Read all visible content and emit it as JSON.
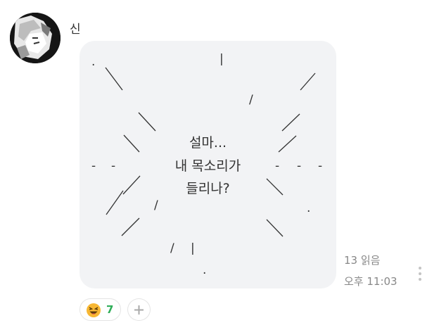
{
  "sender": {
    "name": "신"
  },
  "message": {
    "lines": [
      "설마...",
      "내 목소리가",
      "들리나?"
    ],
    "art_text": {
      "pipe": "|",
      "dot": ".",
      "dash": "-",
      "slash": "/"
    },
    "read_status": "13 읽음",
    "time": "오후 11:03"
  },
  "reaction": {
    "emoji": "laughing-face",
    "count": "7"
  },
  "icons": {
    "more": "vertical-dots-icon",
    "add_reaction": "plus-icon"
  },
  "colors": {
    "bubble": "#f2f3f5",
    "reaction_count": "#2fae59",
    "meta_text": "#888888"
  }
}
